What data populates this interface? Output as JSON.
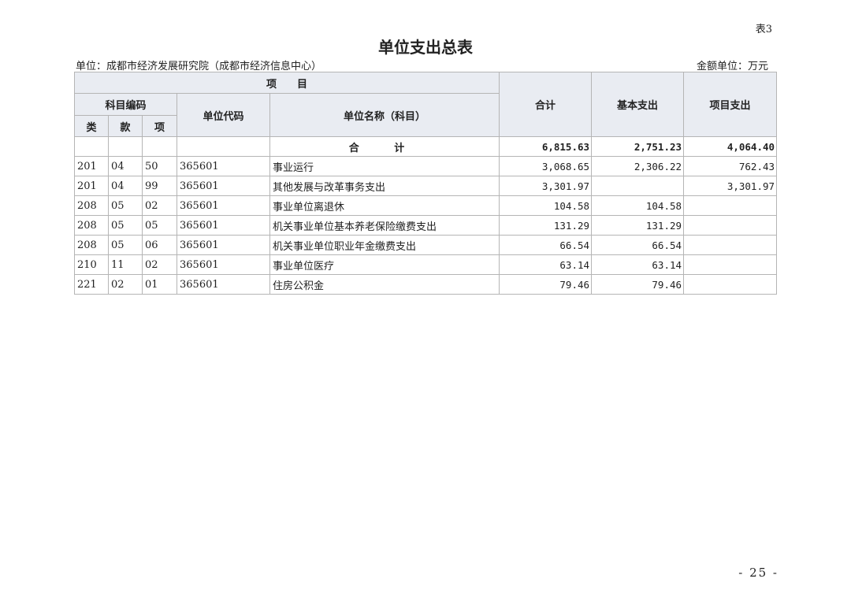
{
  "table_no": "表3",
  "title": "单位支出总表",
  "unit": "单位：成都市经济发展研究院（成都市经济信息中心）",
  "amount_unit": "金额单位：万元",
  "header": {
    "project": "项　　目",
    "subject_code": "科目编码",
    "lei": "类",
    "kuan": "款",
    "xiang": "项",
    "unit_code": "单位代码",
    "unit_name": "单位名称（科目）",
    "total": "合计",
    "basic": "基本支出",
    "project_exp": "项目支出"
  },
  "total_row": {
    "label": "合 计",
    "total": "6,815.63",
    "basic": "2,751.23",
    "project": "4,064.40"
  },
  "rows": [
    {
      "lei": "201",
      "kuan": "04",
      "xiang": "50",
      "code": "365601",
      "name": "事业运行",
      "total": "3,068.65",
      "basic": "2,306.22",
      "project": "762.43"
    },
    {
      "lei": "201",
      "kuan": "04",
      "xiang": "99",
      "code": "365601",
      "name": "其他发展与改革事务支出",
      "total": "3,301.97",
      "basic": "",
      "project": "3,301.97"
    },
    {
      "lei": "208",
      "kuan": "05",
      "xiang": "02",
      "code": "365601",
      "name": "事业单位离退休",
      "total": "104.58",
      "basic": "104.58",
      "project": ""
    },
    {
      "lei": "208",
      "kuan": "05",
      "xiang": "05",
      "code": "365601",
      "name": "机关事业单位基本养老保险缴费支出",
      "total": "131.29",
      "basic": "131.29",
      "project": ""
    },
    {
      "lei": "208",
      "kuan": "05",
      "xiang": "06",
      "code": "365601",
      "name": "机关事业单位职业年金缴费支出",
      "total": "66.54",
      "basic": "66.54",
      "project": ""
    },
    {
      "lei": "210",
      "kuan": "11",
      "xiang": "02",
      "code": "365601",
      "name": "事业单位医疗",
      "total": "63.14",
      "basic": "63.14",
      "project": ""
    },
    {
      "lei": "221",
      "kuan": "02",
      "xiang": "01",
      "code": "365601",
      "name": "住房公积金",
      "total": "79.46",
      "basic": "79.46",
      "project": ""
    }
  ],
  "page_number": "- 25 -"
}
